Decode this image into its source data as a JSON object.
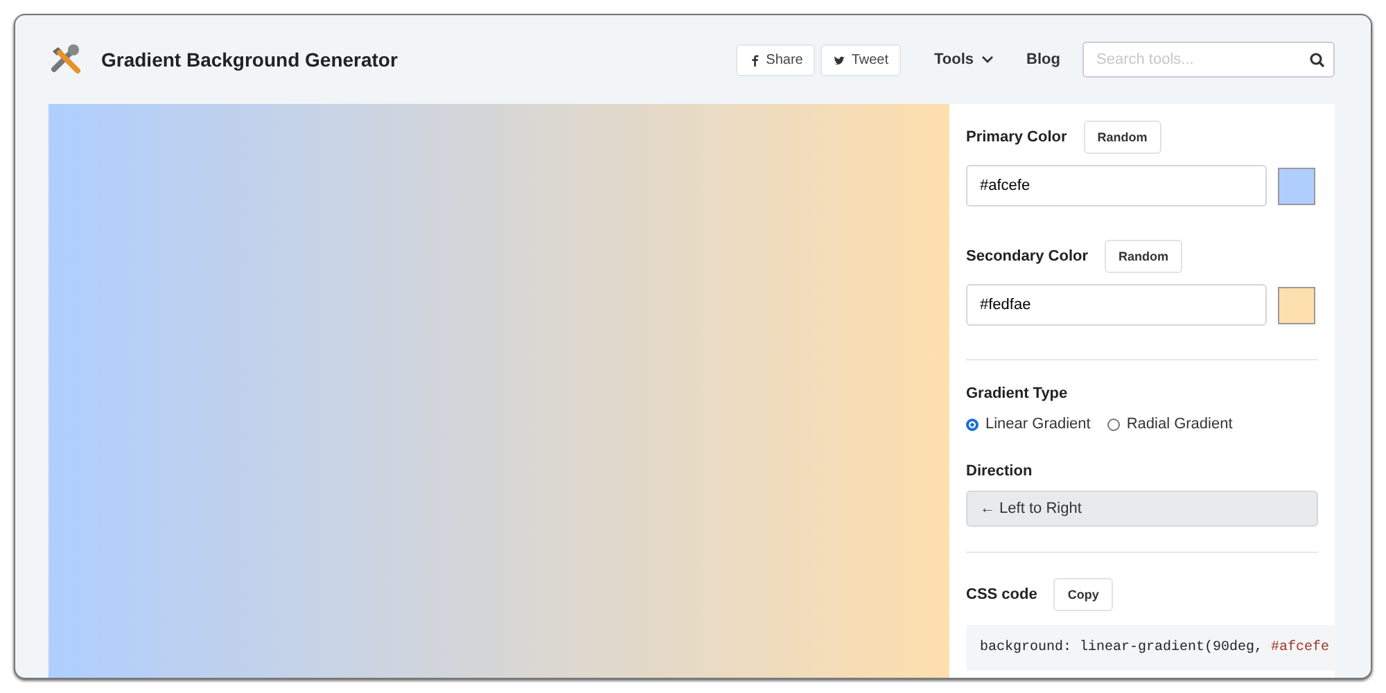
{
  "header": {
    "title": "Gradient Background Generator",
    "share_buttons": [
      {
        "kind": "facebook",
        "label": "Share"
      },
      {
        "kind": "twitter",
        "label": "Tweet"
      }
    ],
    "nav": [
      {
        "label": "Tools",
        "dropdown": true
      },
      {
        "label": "Blog",
        "dropdown": false
      }
    ],
    "search": {
      "placeholder": "Search tools..."
    }
  },
  "panel": {
    "colors": [
      {
        "label": "Primary Color",
        "button": "Random",
        "value": "#afcefe",
        "color": "#afcefe"
      },
      {
        "label": "Secondary Color",
        "button": "Random",
        "value": "#fedfae",
        "color": "#fedfae"
      }
    ],
    "gradient_type": {
      "label": "Gradient Type",
      "options": [
        {
          "label": "Linear Gradient",
          "selected": true
        },
        {
          "label": "Radial Gradient",
          "selected": false
        }
      ]
    },
    "direction": {
      "label": "Direction",
      "value": "← Left to Right"
    },
    "css_code": {
      "label": "CSS code",
      "button": "Copy",
      "tokens": [
        {
          "kind": "plain",
          "text": "background: linear-gradient(90deg, "
        },
        {
          "kind": "value",
          "text": "#afcefe"
        }
      ]
    }
  }
}
